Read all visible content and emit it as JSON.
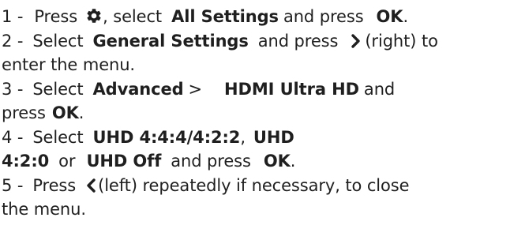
{
  "steps": [
    {
      "number": "1 -",
      "press": "Press",
      "icon": "gear-icon",
      "after_icon": ", select",
      "target": "All Settings",
      "and_press": "and press",
      "ok": "OK",
      "end": "."
    },
    {
      "number": "2 -",
      "select": "Select",
      "target": "General Settings",
      "and_press": "and press",
      "icon": "chevron-right-icon",
      "direction": "(right) to",
      "continuation": "enter the menu."
    },
    {
      "number": "3 -",
      "select": "Select",
      "target": "Advanced",
      "separator": ">",
      "target2": "HDMI Ultra HD",
      "and": "and",
      "press": "press",
      "ok": "OK",
      "end": "."
    },
    {
      "number": "4 -",
      "select": "Select",
      "option1": "UHD 4:4:4/4:2:2",
      "comma": ",",
      "option2a": "UHD",
      "option2b": "4:2:0",
      "or": "or",
      "option3": "UHD Off",
      "and_press": "and press",
      "ok": "OK",
      "end": "."
    },
    {
      "number": "5 -",
      "press": "Press",
      "icon": "chevron-left-icon",
      "direction": "(left) repeatedly if necessary, to close",
      "continuation": "the menu."
    }
  ]
}
